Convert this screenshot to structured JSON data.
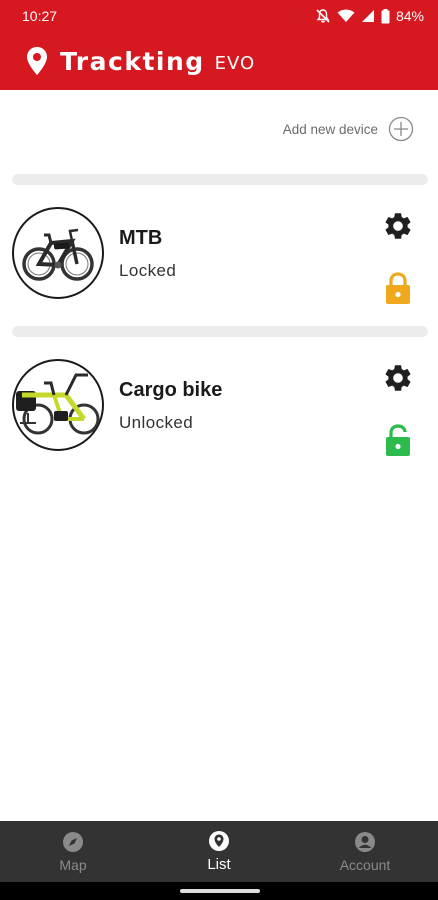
{
  "status_bar": {
    "time": "10:27",
    "battery": "84%"
  },
  "app_bar": {
    "title": "Trackting",
    "subtitle": "EVO"
  },
  "add_device": {
    "label": "Add new device"
  },
  "devices": [
    {
      "name": "MTB",
      "status": "Locked",
      "lock_state": "locked",
      "lock_color": "#f0a81c"
    },
    {
      "name": "Cargo bike",
      "status": "Unlocked",
      "lock_state": "unlocked",
      "lock_color": "#2dbb4e"
    }
  ],
  "bottom_nav": {
    "items": [
      {
        "label": "Map",
        "icon": "compass-icon",
        "active": false
      },
      {
        "label": "List",
        "icon": "location-pin-icon",
        "active": true
      },
      {
        "label": "Account",
        "icon": "account-icon",
        "active": false
      }
    ]
  },
  "colors": {
    "brand": "#d61920",
    "nav_bg": "#333333"
  }
}
